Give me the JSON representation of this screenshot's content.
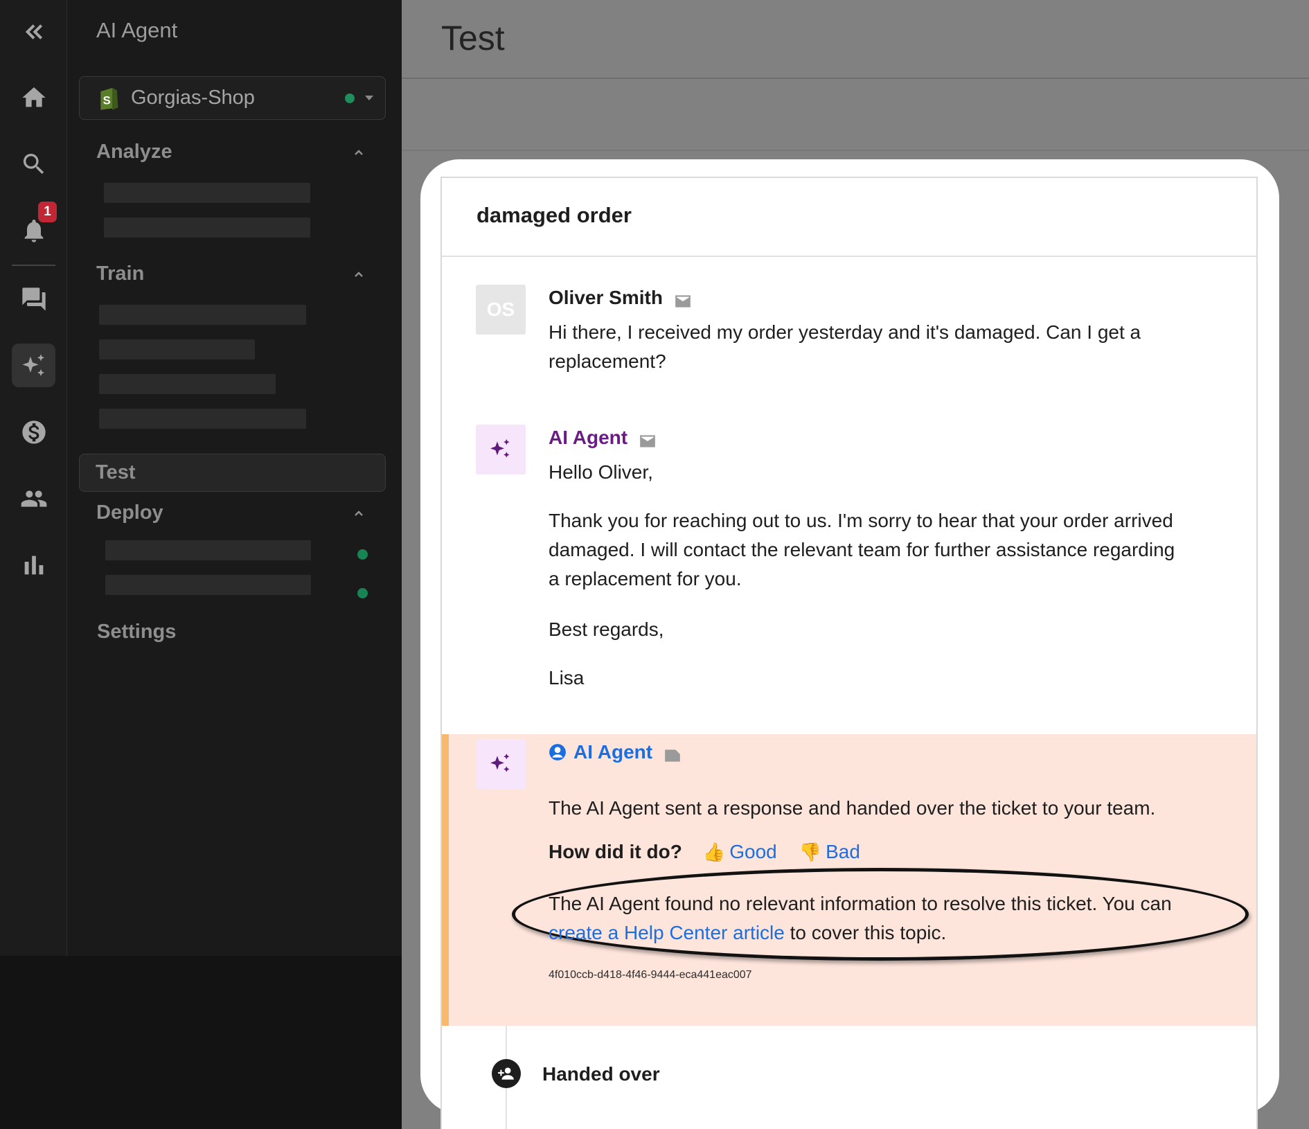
{
  "sidebar": {
    "notification_count": "1"
  },
  "nav": {
    "title": "AI Agent",
    "store": {
      "name": "Gorgias-Shop",
      "status_color": "#1e8e5c"
    },
    "sections": {
      "analyze": "Analyze",
      "train": "Train",
      "test": "Test",
      "deploy": "Deploy",
      "settings": "Settings"
    }
  },
  "main": {
    "title": "Test"
  },
  "ticket": {
    "subject": "damaged order",
    "messages": [
      {
        "author": "Oliver Smith",
        "initials": "OS",
        "lines": [
          "Hi there, I received my order yesterday and it's damaged. Can I get a",
          "replacement?"
        ]
      },
      {
        "author": "AI Agent",
        "greeting": "Hello Oliver,",
        "body_lines": [
          "Thank you for reaching out to us. I'm sorry to hear that your order arrived",
          "damaged. I will contact the relevant team for further assistance regarding",
          "a replacement for you."
        ],
        "closing": "Best regards,",
        "signature": "Lisa"
      }
    ],
    "event": {
      "author": "AI Agent",
      "summary": "The AI Agent sent a response and handed over the ticket to your team.",
      "feedback_question": "How did it do?",
      "feedback_good": "Good",
      "feedback_bad": "Bad",
      "note_prefix": "The AI Agent found no relevant information to resolve this ticket. You can",
      "note_link": "create a Help Center article",
      "note_suffix": "to cover this topic.",
      "ticket_id": "4f010ccb-d418-4f46-9444-eca441eac007"
    },
    "status_event": "Handed over"
  },
  "colors": {
    "accent_link": "#1a6ee1",
    "ai_purple": "#6a1b85",
    "event_bg": "#fee5dc",
    "event_border": "#f7b96d"
  },
  "icons": [
    "collapse-icon",
    "home-icon",
    "search-icon",
    "bell-icon",
    "chat-icon",
    "sparkles-icon",
    "dollar-icon",
    "users-icon",
    "bar-chart-icon",
    "shopify-icon",
    "envelope-icon",
    "internal-note-icon",
    "user-circle-icon",
    "thumbs-up-icon",
    "thumbs-down-icon",
    "user-plus-icon"
  ]
}
